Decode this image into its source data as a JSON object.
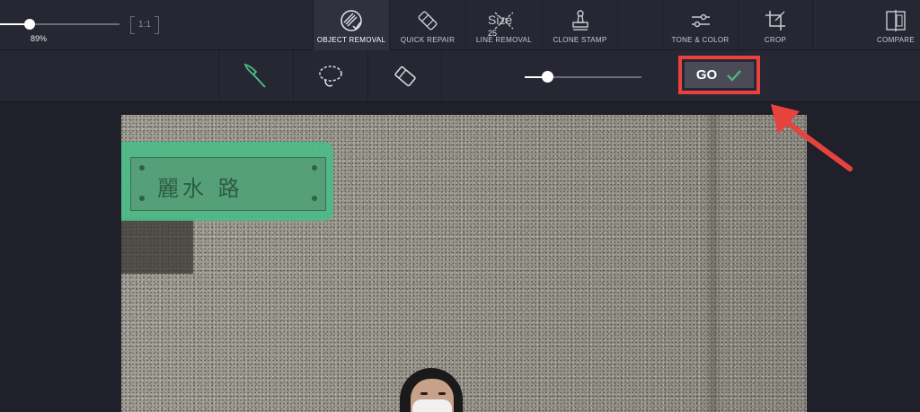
{
  "zoom": {
    "value_label": "89%",
    "level": 0.25,
    "fit_label": "1:1"
  },
  "tools": [
    {
      "id": "object-removal",
      "label": "OBJECT REMOVAL",
      "icon": "object-removal-icon",
      "active": true
    },
    {
      "id": "quick-repair",
      "label": "QUICK REPAIR",
      "icon": "bandage-icon",
      "active": false
    },
    {
      "id": "line-removal",
      "label": "LINE REMOVAL",
      "icon": "line-removal-icon",
      "active": false
    },
    {
      "id": "clone-stamp",
      "label": "CLONE STAMP",
      "icon": "stamp-icon",
      "active": false
    },
    {
      "id": "tone-color",
      "label": "TONE & COLOR",
      "icon": "sliders-icon",
      "active": false
    },
    {
      "id": "crop",
      "label": "CROP",
      "icon": "crop-icon",
      "active": false
    },
    {
      "id": "compare",
      "label": "COMPARE",
      "icon": "compare-icon",
      "active": false
    }
  ],
  "subtools": [
    {
      "id": "brush",
      "icon": "brush-icon",
      "active": true
    },
    {
      "id": "lasso",
      "icon": "lasso-icon",
      "active": false
    },
    {
      "id": "eraser",
      "icon": "eraser-icon",
      "active": false
    }
  ],
  "brush_size": {
    "label": "Size",
    "value": "25",
    "level": 0.19
  },
  "go_button": {
    "label": "GO",
    "icon": "check-icon"
  },
  "photo": {
    "plaque_text": "麗水 路"
  },
  "colors": {
    "accent": "#4cbb86",
    "highlight": "#e8423f",
    "toolbar": "#262733",
    "background": "#1f2029"
  }
}
